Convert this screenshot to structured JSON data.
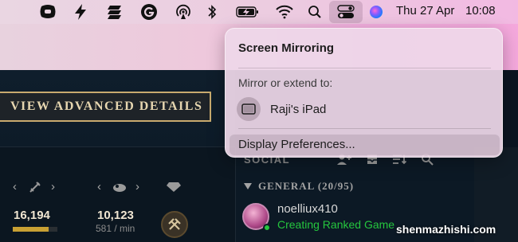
{
  "menubar": {
    "icons": [
      "fist-app-icon",
      "bolt-icon",
      "layers-app-icon",
      "grammarly-icon",
      "airdrop-icon",
      "bluetooth-icon",
      "battery-charging-icon",
      "wifi-icon",
      "spotlight-search-icon",
      "control-center-icon",
      "siri-icon"
    ],
    "clock_date": "Thu 27 Apr",
    "clock_time": "10:08"
  },
  "game": {
    "advanced_button_label": "VIEW ADVANCED DETAILS",
    "stats": [
      {
        "value": "16,194",
        "sub": ""
      },
      {
        "value": "10,123",
        "sub": "581 / min"
      }
    ],
    "social_title": "SOCIAL",
    "group_label": "GENERAL (20/95)",
    "friend": {
      "name": "noelliux410",
      "status": "Creating Ranked Game"
    }
  },
  "popover": {
    "title": "Screen Mirroring",
    "section_label": "Mirror or extend to:",
    "device_name": "Raji's iPad",
    "preferences_label": "Display Preferences..."
  },
  "watermark": "shenmazhishi.com"
}
